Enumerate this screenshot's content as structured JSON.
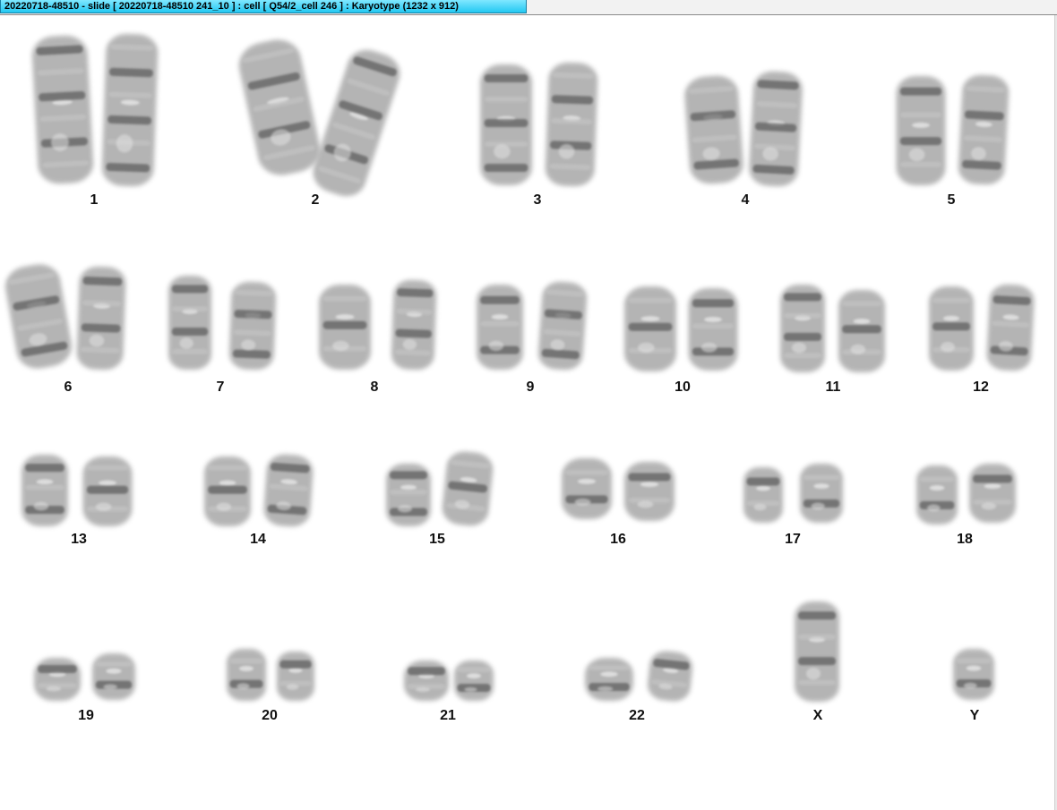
{
  "window": {
    "title": "20220718-48510 - slide [ 20220718-48510 241_10 ] : cell [ Q54/2_cell 246 ] : Karyotype  (1232 x 912)"
  },
  "karyotype": {
    "groups": [
      {
        "label": "1"
      },
      {
        "label": "2"
      },
      {
        "label": "3"
      },
      {
        "label": "4"
      },
      {
        "label": "5"
      },
      {
        "label": "6"
      },
      {
        "label": "7"
      },
      {
        "label": "8"
      },
      {
        "label": "9"
      },
      {
        "label": "10"
      },
      {
        "label": "11"
      },
      {
        "label": "12"
      },
      {
        "label": "13"
      },
      {
        "label": "14"
      },
      {
        "label": "15"
      },
      {
        "label": "16"
      },
      {
        "label": "17"
      },
      {
        "label": "18"
      },
      {
        "label": "19"
      },
      {
        "label": "20"
      },
      {
        "label": "21"
      },
      {
        "label": "22"
      },
      {
        "label": "X"
      },
      {
        "label": "Y"
      }
    ]
  }
}
